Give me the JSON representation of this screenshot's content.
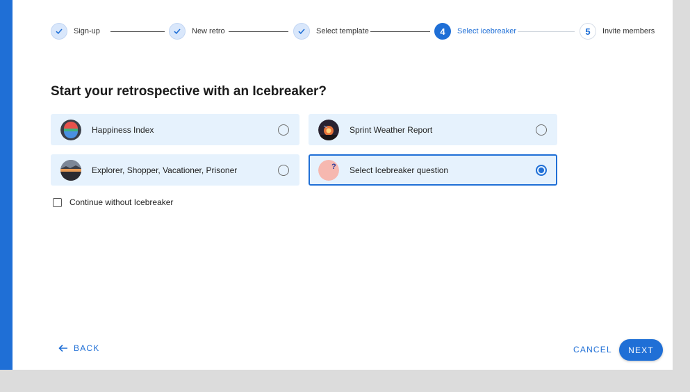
{
  "stepper": {
    "steps": [
      {
        "label": "Sign-up",
        "state": "done",
        "number": ""
      },
      {
        "label": "New retro",
        "state": "done",
        "number": ""
      },
      {
        "label": "Select template",
        "state": "done",
        "number": ""
      },
      {
        "label": "Select icebreaker",
        "state": "active",
        "number": "4"
      },
      {
        "label": "Invite members",
        "state": "pending",
        "number": "5"
      }
    ]
  },
  "page_title": "Start your retrospective with an Icebreaker?",
  "options": [
    {
      "label": "Happiness Index",
      "icon": "happiness-thumbnail",
      "selected": false
    },
    {
      "label": "Sprint Weather Report",
      "icon": "weather-thumbnail",
      "selected": false
    },
    {
      "label": "Explorer, Shopper, Vacationer, Prisoner",
      "icon": "landscape-thumbnail",
      "selected": false
    },
    {
      "label": "Select Icebreaker question",
      "icon": "question-thumbnail",
      "selected": true
    }
  ],
  "continue_without": {
    "label": "Continue without Icebreaker",
    "checked": false
  },
  "footer": {
    "back_label": "BACK",
    "cancel_label": "CANCEL",
    "next_label": "NEXT"
  },
  "colors": {
    "accent": "#1f6fd6",
    "option_bg": "#e6f2fd",
    "backdrop": "#dcdcdc"
  }
}
